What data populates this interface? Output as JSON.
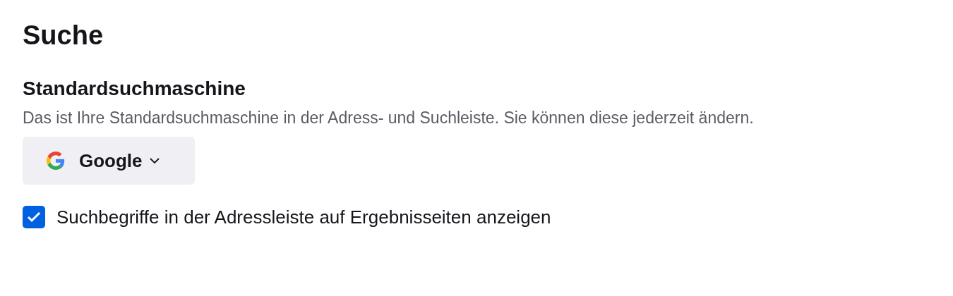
{
  "section": {
    "title": "Suche"
  },
  "search_engine": {
    "heading": "Standardsuchmaschine",
    "description": "Das ist Ihre Standardsuchmaschine in der Adress- und Suchleiste. Sie können diese jederzeit ändern.",
    "dropdown": {
      "value": "Google"
    }
  },
  "option": {
    "label": "Suchbegriffe in der Adressleiste auf Ergebnisseiten anzeigen",
    "checked": true
  }
}
